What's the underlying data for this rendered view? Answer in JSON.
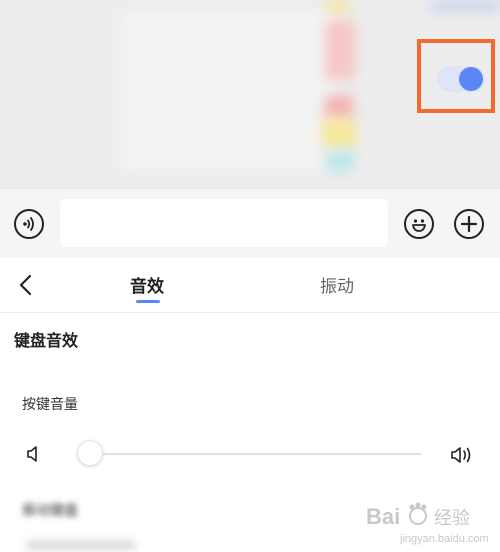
{
  "input_bar": {
    "voice_icon": "voice-wave-icon",
    "emoji_icon": "smiley-icon",
    "plus_icon": "plus-icon"
  },
  "panel": {
    "back_icon": "chevron-left-icon",
    "tabs": [
      {
        "label": "音效",
        "active": true
      },
      {
        "label": "振动",
        "active": false
      }
    ],
    "keyboard_sound": {
      "label": "键盘音效",
      "enabled": true
    },
    "key_volume": {
      "label": "按键音量",
      "value_fraction": 0.0
    },
    "blurred_item": {
      "label": "振动键盘"
    }
  },
  "colors": {
    "accent": "#5b86f5",
    "highlight_frame": "#f06b2d"
  },
  "watermark": {
    "text": "Bai du 经验"
  }
}
